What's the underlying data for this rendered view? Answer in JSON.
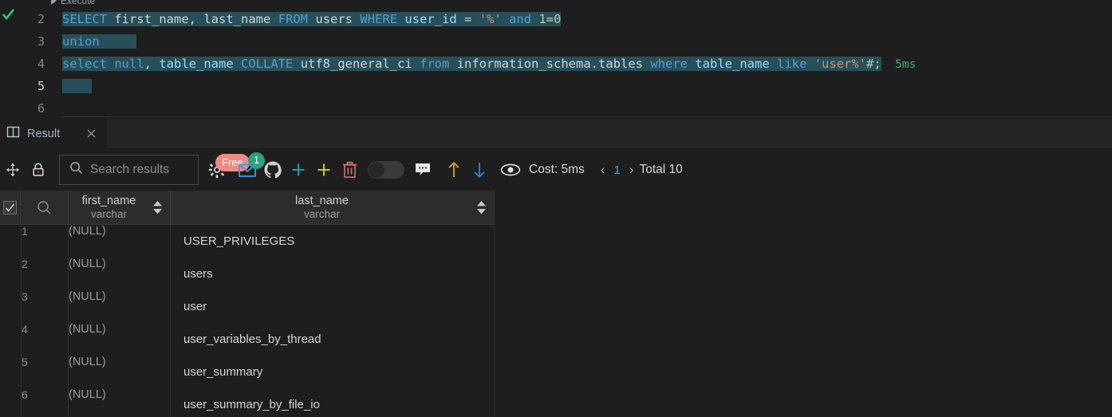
{
  "editor": {
    "execute_label": "Execute",
    "play_icon": "play-icon",
    "status_icon": "check-icon",
    "line_numbers": [
      "2",
      "3",
      "4",
      "5",
      "6"
    ],
    "active_line": "5",
    "lines": [
      {
        "number": "2",
        "tokens": [
          {
            "t": "SELECT",
            "c": "kw"
          },
          {
            "t": " ",
            "c": "punc"
          },
          {
            "t": "first_name",
            "c": "id"
          },
          {
            "t": ", ",
            "c": "punc"
          },
          {
            "t": "last_name",
            "c": "id"
          },
          {
            "t": " ",
            "c": "punc"
          },
          {
            "t": "FROM",
            "c": "kw"
          },
          {
            "t": " ",
            "c": "punc"
          },
          {
            "t": "users",
            "c": "id"
          },
          {
            "t": " ",
            "c": "punc"
          },
          {
            "t": "WHERE",
            "c": "kw"
          },
          {
            "t": " ",
            "c": "punc"
          },
          {
            "t": "user_id",
            "c": "col"
          },
          {
            "t": " = ",
            "c": "punc"
          },
          {
            "t": "'%'",
            "c": "str"
          },
          {
            "t": " ",
            "c": "punc"
          },
          {
            "t": "and",
            "c": "kw"
          },
          {
            "t": " ",
            "c": "punc"
          },
          {
            "t": "1",
            "c": "num"
          },
          {
            "t": "=",
            "c": "punc"
          },
          {
            "t": "0",
            "c": "num"
          }
        ]
      },
      {
        "number": "3",
        "tokens": [
          {
            "t": "union",
            "c": "kw"
          },
          {
            "t": "     ",
            "c": "punc"
          }
        ]
      },
      {
        "number": "4",
        "tokens": [
          {
            "t": "select",
            "c": "kw"
          },
          {
            "t": " ",
            "c": "punc"
          },
          {
            "t": "null",
            "c": "kw"
          },
          {
            "t": ", ",
            "c": "punc"
          },
          {
            "t": "table_name",
            "c": "col"
          },
          {
            "t": " ",
            "c": "punc"
          },
          {
            "t": "COLLATE",
            "c": "kw"
          },
          {
            "t": " ",
            "c": "punc"
          },
          {
            "t": "utf8_general_ci",
            "c": "id"
          },
          {
            "t": " ",
            "c": "punc"
          },
          {
            "t": "from",
            "c": "kw"
          },
          {
            "t": " ",
            "c": "punc"
          },
          {
            "t": "information_schema.tables",
            "c": "id"
          },
          {
            "t": " ",
            "c": "punc"
          },
          {
            "t": "where",
            "c": "kw"
          },
          {
            "t": " ",
            "c": "punc"
          },
          {
            "t": "table_name",
            "c": "col"
          },
          {
            "t": " ",
            "c": "punc"
          },
          {
            "t": "like",
            "c": "kw"
          },
          {
            "t": " ",
            "c": "punc"
          },
          {
            "t": "'user%'",
            "c": "str"
          },
          {
            "t": "#;",
            "c": "num"
          }
        ]
      },
      {
        "number": "5",
        "tokens": [
          {
            "t": "    ",
            "c": "punc"
          }
        ]
      },
      {
        "number": "6",
        "tokens": []
      }
    ],
    "line4_exec_time": "5ms"
  },
  "tab": {
    "icon": "split-panel-icon",
    "label": "Result",
    "close_icon": "close-icon"
  },
  "toolbar": {
    "move_icon": "move-arrows-icon",
    "lock_icon": "lock-icon",
    "search": {
      "placeholder": "Search results",
      "icon": "search-icon",
      "value": ""
    },
    "gear": {
      "icon": "gear-icon",
      "badge": "Free",
      "badge_color": "#f08a84"
    },
    "mail": {
      "icon": "mail-icon",
      "badge": "1",
      "badge_color": "#2aa188"
    },
    "github_icon": "github-icon",
    "add_teal_icon": "plus-icon",
    "add_yellow_icon": "plus-icon",
    "delete_icon": "trash-icon",
    "toggle": {
      "icon": "toggle-switch",
      "state": "off"
    },
    "comment_icon": "comment-icon",
    "upload_icon": "arrow-up-icon",
    "download_icon": "arrow-down-icon",
    "preview_icon": "eye-icon",
    "cost_label": "Cost: 5ms",
    "prev_icon": "chevron-left-icon",
    "page_number": "1",
    "next_icon": "chevron-right-icon",
    "total_label": "Total 10"
  },
  "result_table": {
    "header_checkbox": "checkbox-checked",
    "row_search_icon": "search-icon",
    "columns": [
      {
        "name": "first_name",
        "type": "varchar",
        "sort_icon": "sort-arrows-icon"
      },
      {
        "name": "last_name",
        "type": "varchar",
        "sort_icon": "sort-arrows-icon"
      }
    ],
    "rows": [
      {
        "index": "1",
        "first_name": "(NULL)",
        "last_name": "USER_PRIVILEGES"
      },
      {
        "index": "2",
        "first_name": "(NULL)",
        "last_name": "users"
      },
      {
        "index": "3",
        "first_name": "(NULL)",
        "last_name": "user"
      },
      {
        "index": "4",
        "first_name": "(NULL)",
        "last_name": "user_variables_by_thread"
      },
      {
        "index": "5",
        "first_name": "(NULL)",
        "last_name": "user_summary"
      },
      {
        "index": "6",
        "first_name": "(NULL)",
        "last_name": "user_summary_by_file_io"
      }
    ]
  }
}
